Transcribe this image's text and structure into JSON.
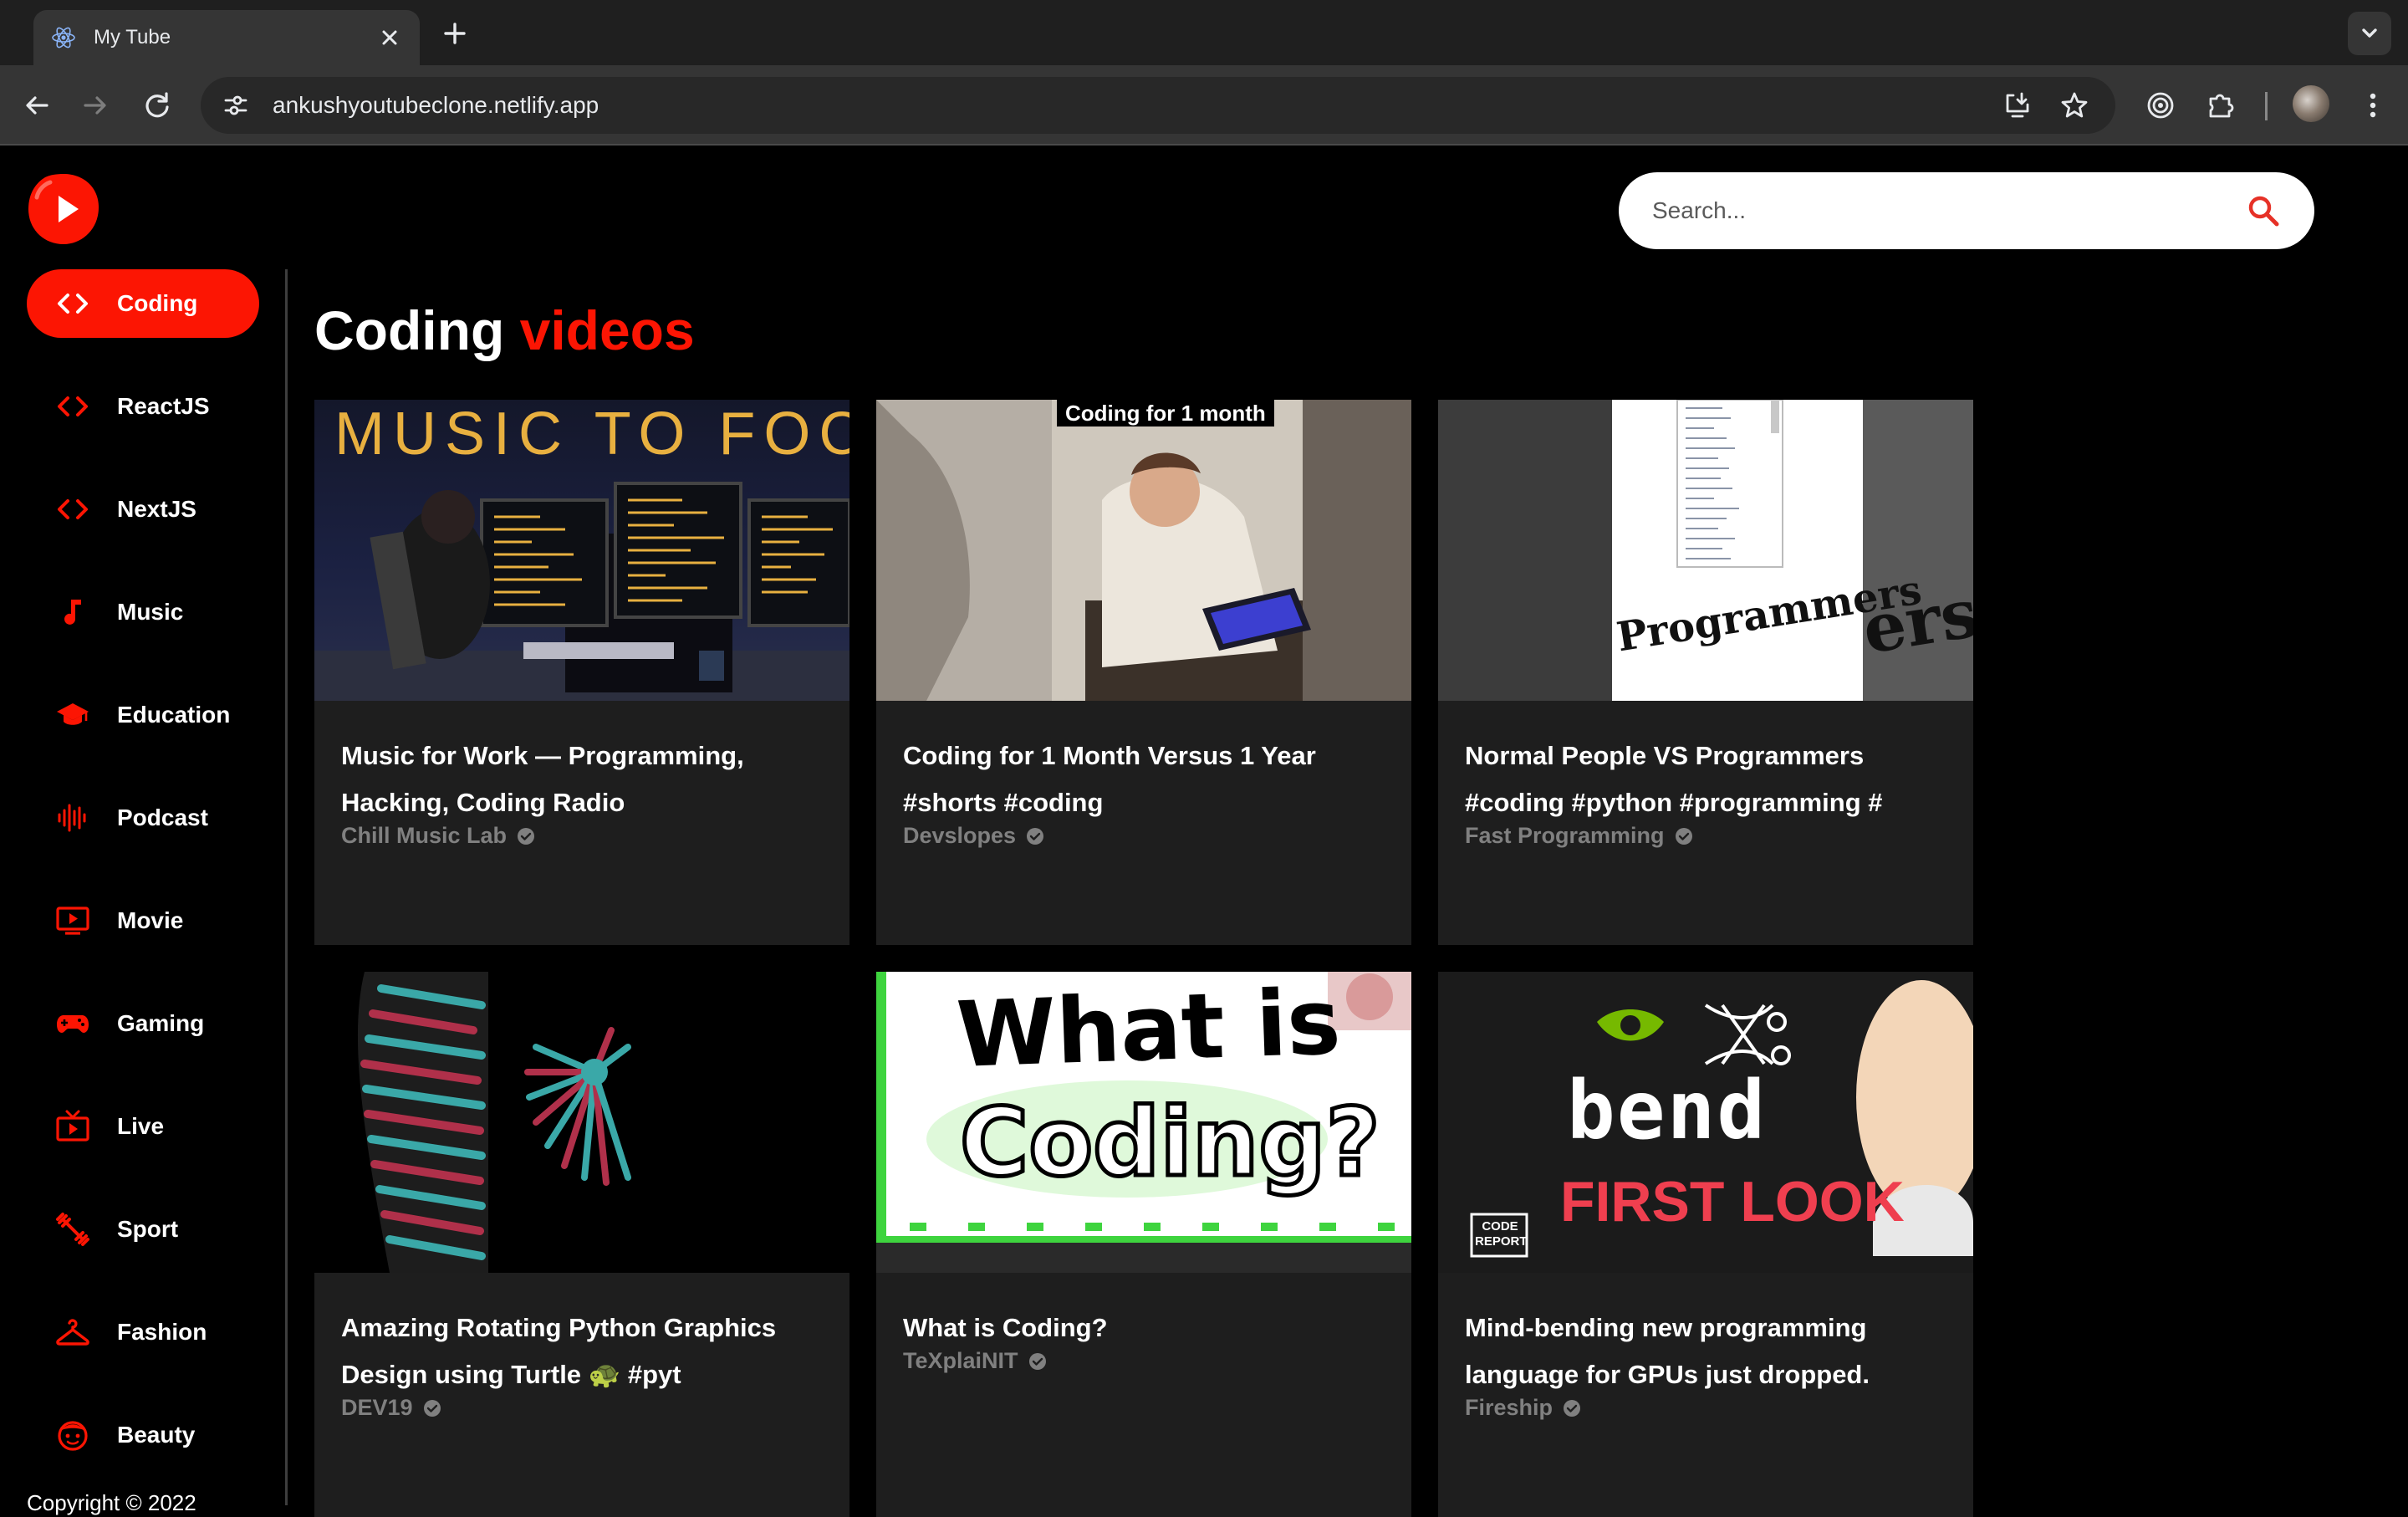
{
  "browser": {
    "tab_title": "My Tube",
    "url": "ankushyoutubeclone.netlify.app"
  },
  "app": {
    "search_placeholder": "Search...",
    "heading_main": "Coding",
    "heading_accent": "videos",
    "copyright": "Copyright © 2022"
  },
  "sidebar": {
    "items": [
      {
        "label": "Coding",
        "icon": "code-icon",
        "active": true
      },
      {
        "label": "ReactJS",
        "icon": "code-icon"
      },
      {
        "label": "NextJS",
        "icon": "code-icon"
      },
      {
        "label": "Music",
        "icon": "music-note-icon"
      },
      {
        "label": "Education",
        "icon": "graduation-cap-icon"
      },
      {
        "label": "Podcast",
        "icon": "graphic-eq-icon"
      },
      {
        "label": "Movie",
        "icon": "ondemand-video-icon"
      },
      {
        "label": "Gaming",
        "icon": "gamepad-icon"
      },
      {
        "label": "Live",
        "icon": "live-tv-icon"
      },
      {
        "label": "Sport",
        "icon": "fitness-icon"
      },
      {
        "label": "Fashion",
        "icon": "hanger-icon"
      },
      {
        "label": "Beauty",
        "icon": "face-icon"
      }
    ]
  },
  "videos": [
    {
      "title": "Music for Work — Programming, Hacking, Coding Radio",
      "channel": "Chill Music Lab",
      "thumb_text": "MUSIC TO FOCU"
    },
    {
      "title": "Coding for 1 Month Versus 1 Year #shorts #coding",
      "channel": "Devslopes",
      "thumb_text": "Coding for 1 month"
    },
    {
      "title": "Normal People VS Programmers #coding #python #programming #",
      "channel": "Fast Programming",
      "thumb_text": "Programmers"
    },
    {
      "title": "Amazing Rotating Python Graphics Design using Turtle 🐢 #pyt",
      "channel": "DEV19"
    },
    {
      "title": "What is Coding?",
      "channel": "TeXplaiNIT",
      "thumb_text_1": "What is",
      "thumb_text_2": "Coding?"
    },
    {
      "title": "Mind-bending new programming language for GPUs just dropped.",
      "channel": "Fireship",
      "thumb_text_1": "bend",
      "thumb_text_2": "FIRST LOOK",
      "thumb_badge": "CODE REPORT"
    }
  ],
  "colors": {
    "accent": "#fc1503",
    "card_bg": "#1e1e1e",
    "channel_text": "#808080"
  }
}
